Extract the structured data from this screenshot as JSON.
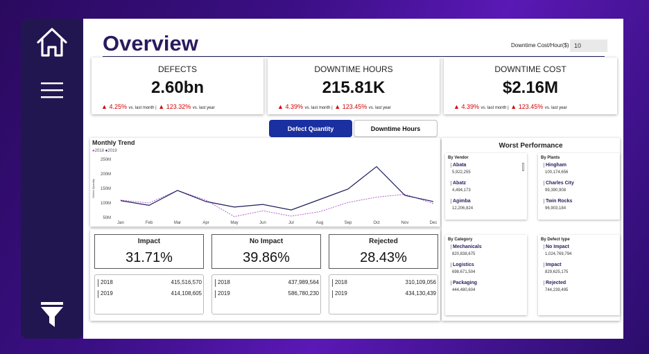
{
  "page": {
    "title": "Overview"
  },
  "downtime_cost": {
    "label": "Downtime Cost/Hour($)",
    "value": "10"
  },
  "kpis": [
    {
      "title": "DEFECTS",
      "value": "2.60bn",
      "month_pct": "4.25%",
      "month_label": "vs. last month |",
      "year_pct": "123.32%",
      "year_label": "vs. last year"
    },
    {
      "title": "DOWNTIME HOURS",
      "value": "215.81K",
      "month_pct": "4.39%",
      "month_label": "vs. last month |",
      "year_pct": "123.45%",
      "year_label": "vs. last year"
    },
    {
      "title": "DOWNTIME COST",
      "value": "$2.16M",
      "month_pct": "4.39%",
      "month_label": "vs. last month |",
      "year_pct": "123.45%",
      "year_label": "vs. last year"
    }
  ],
  "toggle": {
    "active": "Defect Quantity",
    "inactive": "Downtime Hours"
  },
  "chart_data": {
    "type": "line",
    "title": "Monthly Trend",
    "ylabel": "Defect Quantity",
    "categories": [
      "Jan",
      "Feb",
      "Mar",
      "Apr",
      "May",
      "Jun",
      "Jul",
      "Aug",
      "Sep",
      "Oct",
      "Nov",
      "Dec"
    ],
    "y_ticks": [
      "250M",
      "200M",
      "150M",
      "100M",
      "50M"
    ],
    "ylim": [
      50,
      250
    ],
    "series": [
      {
        "name": "2018",
        "color": "#b04ac9",
        "dashed": true,
        "values": [
          110,
          100,
          143,
          110,
          53,
          73,
          55,
          70,
          102,
          120,
          130,
          98
        ]
      },
      {
        "name": "2019",
        "color": "#1b1b5a",
        "dashed": false,
        "values": [
          108,
          92,
          143,
          105,
          86,
          95,
          76,
          112,
          148,
          225,
          126,
          105
        ]
      }
    ]
  },
  "impact": [
    {
      "label": "Impact",
      "pct": "31.71%",
      "rows": [
        {
          "year": "2018",
          "value": "415,516,570"
        },
        {
          "year": "2019",
          "value": "414,108,605"
        }
      ]
    },
    {
      "label": "No Impact",
      "pct": "39.86%",
      "rows": [
        {
          "year": "2018",
          "value": "437,989,564"
        },
        {
          "year": "2019",
          "value": "586,780,230"
        }
      ]
    },
    {
      "label": "Rejected",
      "pct": "28.43%",
      "rows": [
        {
          "year": "2018",
          "value": "310,109,056"
        },
        {
          "year": "2019",
          "value": "434,130,439"
        }
      ]
    }
  ],
  "worst": {
    "title": "Worst Performance",
    "vendor": {
      "head": "By Vendor",
      "items": [
        {
          "name": "Abata",
          "value": "5,922,255"
        },
        {
          "name": "Abatz",
          "value": "4,494,173"
        },
        {
          "name": "Agimba",
          "value": "12,206,824"
        }
      ]
    },
    "plants": {
      "head": "By Plants",
      "items": [
        {
          "name": "Hingham",
          "value": "100,174,656"
        },
        {
          "name": "Charles City",
          "value": "99,390,908"
        },
        {
          "name": "Twin Rocks",
          "value": "96,903,184"
        }
      ]
    },
    "category": {
      "head": "By Category",
      "items": [
        {
          "name": "Mechanicals",
          "value": "820,838,675"
        },
        {
          "name": "Logistics",
          "value": "698,671,504"
        },
        {
          "name": "Packaging",
          "value": "444,480,604"
        }
      ]
    },
    "defect": {
      "head": "By Defect type",
      "items": [
        {
          "name": "No Impact",
          "value": "1,024,769,794"
        },
        {
          "name": "Impact",
          "value": "829,625,175"
        },
        {
          "name": "Rejected",
          "value": "744,239,495"
        }
      ]
    }
  },
  "icons": {
    "home": "home-icon",
    "menu": "menu-icon",
    "filter": "filter-icon"
  }
}
